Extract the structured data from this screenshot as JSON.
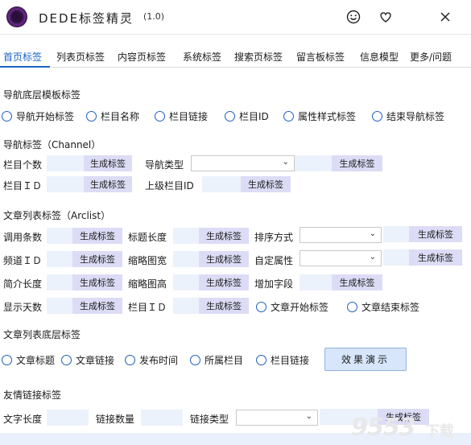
{
  "app": {
    "title": "DEDE标签精灵",
    "version": "(1.0)"
  },
  "tabs": [
    "首页标签",
    "列表页标签",
    "内容页标签",
    "系统标签",
    "搜索页标签",
    "留言板标签",
    "信息模型",
    "更多/问题"
  ],
  "gen_label": "生成标签",
  "sections": {
    "nav_bottom": {
      "title": "导航底层模板标签",
      "radios": [
        "导航开始标签",
        "栏目名称",
        "栏目链接",
        "栏目ID",
        "属性样式标签",
        "结束导航标签"
      ]
    },
    "channel": {
      "title": "导航标签（Channel）",
      "labels": {
        "count": "栏目个数",
        "nav_type": "导航类型",
        "cat_id": "栏目ＩＤ",
        "parent_id": "上级栏目ID"
      }
    },
    "arclist": {
      "title": "文章列表标签（Arclist）",
      "labels": {
        "call_count": "调用条数",
        "title_len": "标题长度",
        "sort": "排序方式",
        "channel_id": "频道ＩＤ",
        "thumb_w": "缩略图宽",
        "custom_attr": "自定属性",
        "intro_len": "简介长度",
        "thumb_h": "缩略图高",
        "add_field": "增加字段",
        "show_days": "显示天数",
        "cat_id": "栏目ＩＤ"
      },
      "radios": [
        "文章开始标签",
        "文章结束标签"
      ]
    },
    "list_bottom": {
      "title": "文章列表底层标签",
      "radios": [
        "文章标题",
        "文章链接",
        "发布时间",
        "所属栏目",
        "栏目链接"
      ],
      "demo_button": "效果演示"
    },
    "friend": {
      "title": "友情链接标签",
      "labels": {
        "text_len": "文字长度",
        "link_count": "链接数量",
        "link_type": "链接类型"
      }
    }
  },
  "watermark": {
    "number": "9553",
    "text": "下载"
  }
}
